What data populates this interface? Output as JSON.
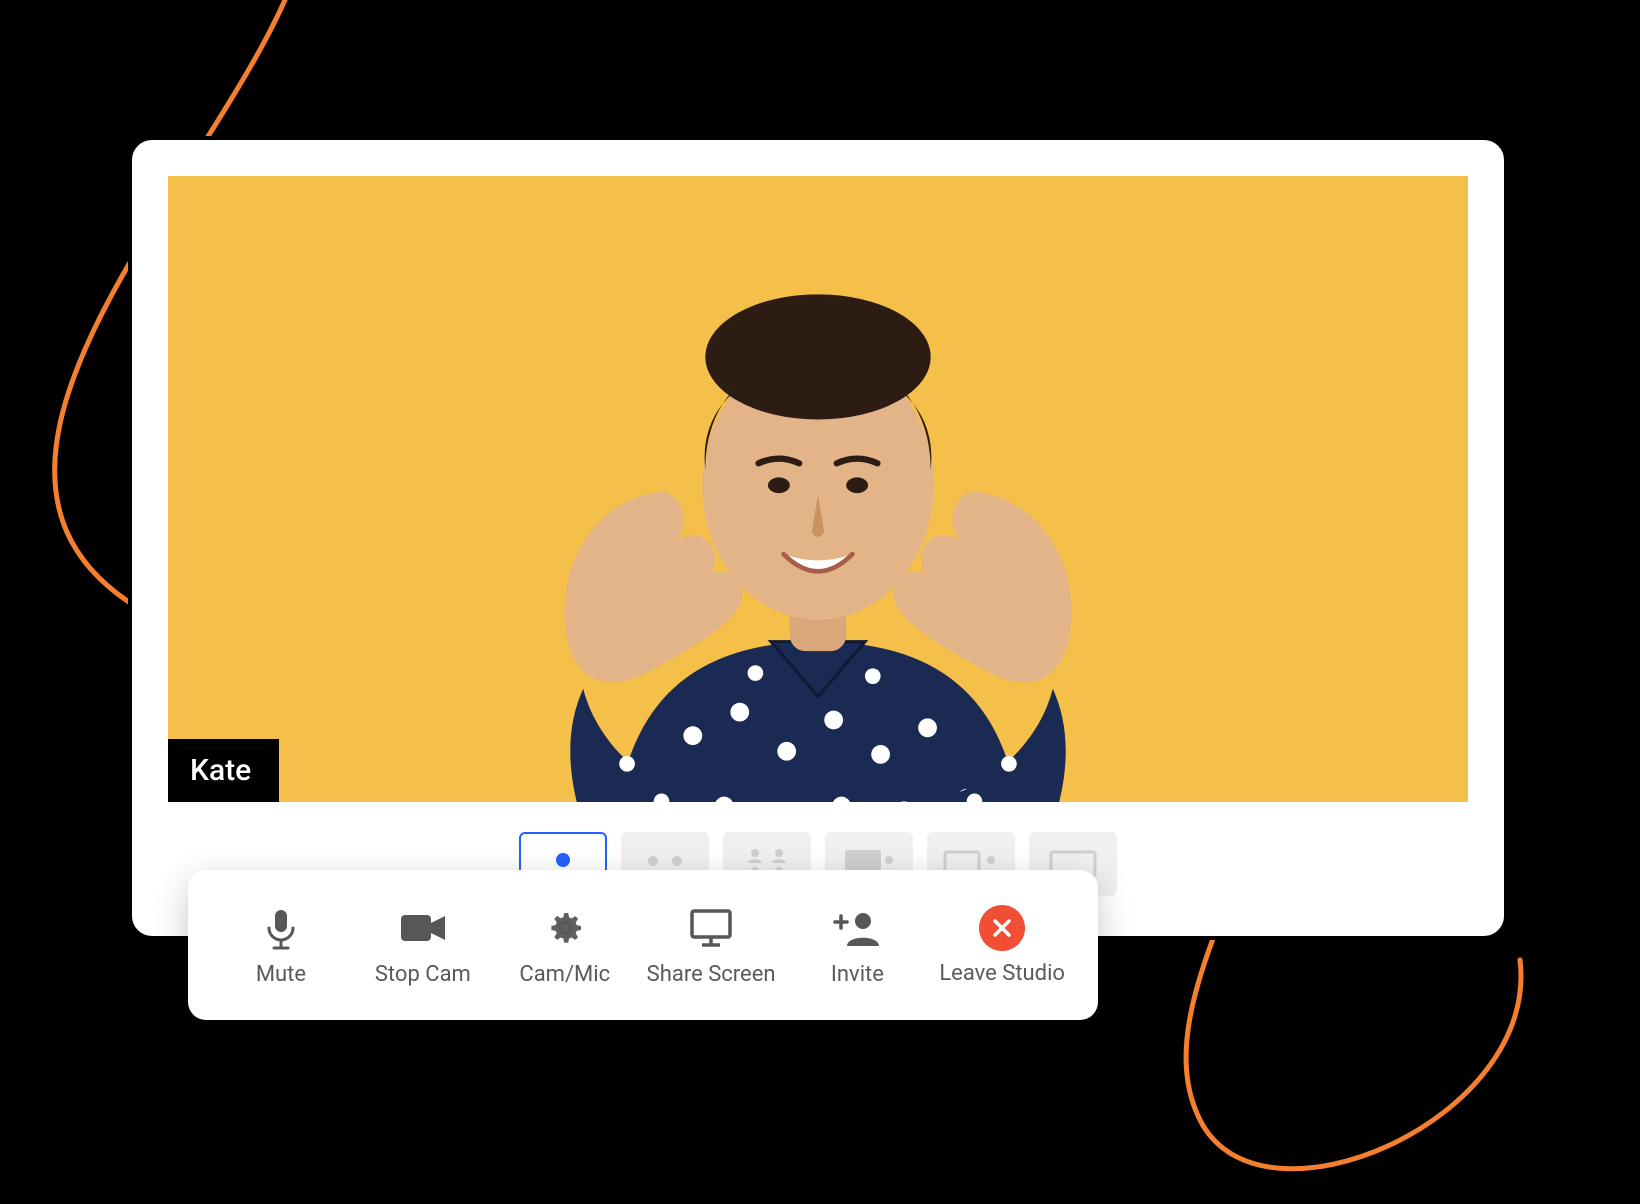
{
  "participant": {
    "name": "Kate"
  },
  "layouts": {
    "count": 6,
    "selected_index": 0,
    "options": [
      {
        "icon": "single-speaker",
        "selected": true
      },
      {
        "icon": "two-speakers",
        "selected": false
      },
      {
        "icon": "grid-speakers",
        "selected": false
      },
      {
        "icon": "screen-with-speaker",
        "selected": false
      },
      {
        "icon": "screen-side-speaker",
        "selected": false
      },
      {
        "icon": "screen-only",
        "selected": false
      }
    ]
  },
  "toolbar": {
    "mute_label": "Mute",
    "stop_cam_label": "Stop Cam",
    "cam_mic_label": "Cam/Mic",
    "share_screen_label": "Share Screen",
    "invite_label": "Invite",
    "leave_label": "Leave Studio"
  },
  "colors": {
    "accent_blue": "#2362ff",
    "video_bg": "#f5c04a",
    "leave_red": "#f04e35",
    "swoosh": "#f57f2e"
  }
}
